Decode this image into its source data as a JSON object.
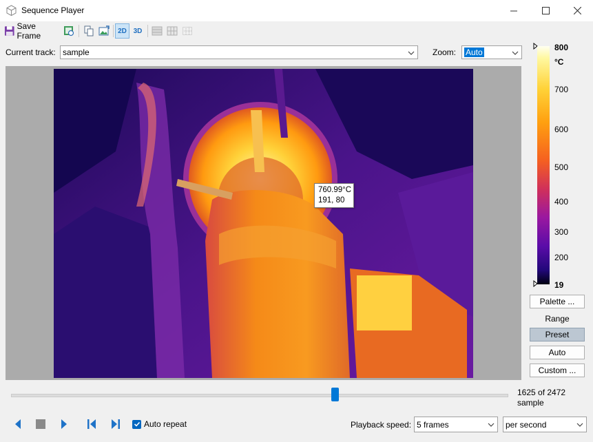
{
  "window": {
    "title": "Sequence Player"
  },
  "toolbar": {
    "save_frame_label": "Save Frame",
    "view_2d_label": "2D",
    "view_3d_label": "3D"
  },
  "track": {
    "label": "Current track:",
    "value": "sample"
  },
  "zoom": {
    "label": "Zoom:",
    "value": "Auto"
  },
  "image": {
    "tooltip_temperature": "760.99°C",
    "tooltip_coords": "191, 80"
  },
  "color_scale": {
    "max_label": "800",
    "unit": "°C",
    "ticks": [
      "700",
      "600",
      "500",
      "400",
      "300",
      "200"
    ],
    "min_label": "19"
  },
  "side_panel": {
    "palette_button": "Palette ...",
    "range_label": "Range",
    "preset_button": "Preset",
    "auto_button": "Auto",
    "custom_button": "Custom ..."
  },
  "timeline": {
    "frame_counter": "1625 of 2472",
    "track_name": "sample",
    "position_fraction": 0.657
  },
  "playback": {
    "auto_repeat_label": "Auto repeat",
    "auto_repeat_checked": true,
    "speed_label": "Playback speed:",
    "speed_value": "5 frames",
    "speed_unit": "per second"
  },
  "colors": {
    "accent": "#0078d7",
    "preset_active": "#bcc7d2"
  }
}
